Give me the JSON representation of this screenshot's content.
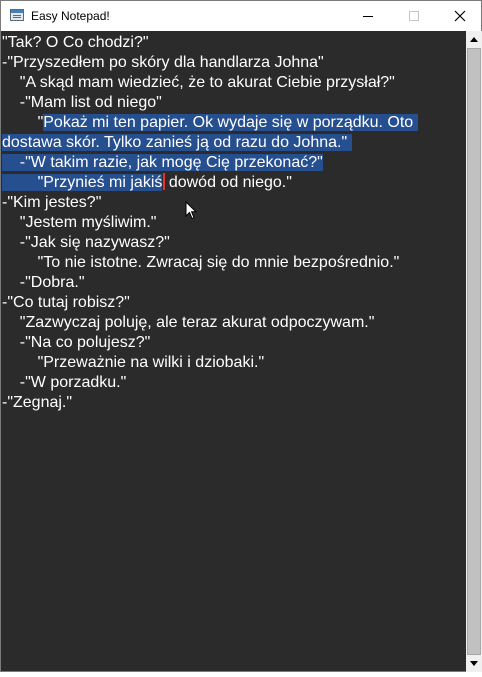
{
  "window": {
    "title": "Easy Notepad!"
  },
  "editor": {
    "lines": [
      "\"Tak? O Co chodzi?\"",
      "-\"Przyszedłem po skóry dla handlarza Johna\"",
      "    \"A skąd mam wiedzieć, że to akurat Ciebie przysłał?\"",
      "    -\"Mam list od niego\"",
      "        \"",
      "Pokaż mi ten papier. Ok wydaje się w porządku. Oto ",
      "dostawa skór. Tylko zanieś ją od razu do Johna.\" ",
      "    -\"W takim razie, jak mogę Cię przekonać?\"",
      "        \"Przynieś mi jakiś",
      " dowód od niego.\"",
      "-\"Kim jestes?\"",
      "    \"Jestem myśliwim.\"",
      "    -\"Jak się nazywasz?\"",
      "        \"To nie istotne. Zwracaj się do mnie bezpośrednio.\"",
      "    -\"Dobra.\"",
      "-\"Co tutaj robisz?\"",
      "    \"Zazwyczaj poluję, ale teraz akurat odpoczywam.\"",
      "    -\"Na co polujesz?\"",
      "        \"Przeważnie na wilki i dziobaki.\"",
      "    -\"W porzadku.\"",
      "-\"Zegnaj.\""
    ],
    "colors": {
      "background": "#2b2b2b",
      "text": "#ffffff",
      "selection": "#264f8f",
      "caret": "#e8322b"
    }
  },
  "icons": {
    "app": "notepad-icon",
    "minimize": "minimize-icon",
    "maximize": "maximize-icon",
    "close": "close-icon",
    "scroll_up": "scroll-up-arrow-icon",
    "scroll_down": "scroll-down-arrow-icon",
    "cursor": "mouse-pointer-icon"
  }
}
